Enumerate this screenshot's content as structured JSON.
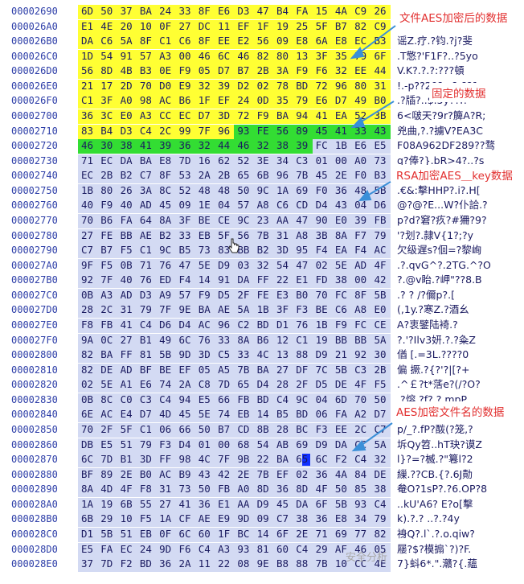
{
  "hex_view": {
    "rows": [
      {
        "addr": "00002690",
        "bytes": [
          "6D",
          "50",
          "37",
          "BA",
          "24",
          "33",
          "8F",
          "E6",
          "D3",
          "47",
          "B4",
          "FA",
          "15",
          "4A",
          "C9",
          "26"
        ],
        "ascii": ""
      },
      {
        "addr": "000026A0",
        "bytes": [
          "E1",
          "4E",
          "20",
          "10",
          "0F",
          "27",
          "DC",
          "11",
          "EF",
          "1F",
          "19",
          "25",
          "5F",
          "B7",
          "82",
          "C9"
        ],
        "ascii": ""
      },
      {
        "addr": "000026B0",
        "bytes": [
          "DA",
          "C6",
          "5A",
          "8F",
          "C1",
          "C6",
          "8F",
          "EE",
          "E2",
          "56",
          "09",
          "E8",
          "6A",
          "E8",
          "EC",
          "B3"
        ],
        "ascii": "谣Z.疗.?钧.?j?斐"
      },
      {
        "addr": "000026C0",
        "bytes": [
          "1D",
          "54",
          "91",
          "57",
          "A3",
          "00",
          "46",
          "6C",
          "46",
          "82",
          "80",
          "13",
          "3F",
          "35",
          "79",
          "6F"
        ],
        "ascii": ".T憼?'F1F?..?5yo"
      },
      {
        "addr": "000026D0",
        "bytes": [
          "56",
          "8D",
          "4B",
          "B3",
          "0E",
          "F9",
          "05",
          "D7",
          "B7",
          "2B",
          "3A",
          "F9",
          "F6",
          "32",
          "EE",
          "44"
        ],
        "ascii": "V.K?.?.?:???頓"
      },
      {
        "addr": "000026E0",
        "bytes": [
          "21",
          "17",
          "2D",
          "70",
          "D0",
          "E9",
          "32",
          "39",
          "D2",
          "02",
          "78",
          "BD",
          "72",
          "96",
          "80",
          "31"
        ],
        "ascii": "!.-p??29?.x?r??1"
      },
      {
        "addr": "000026F0",
        "bytes": [
          "C1",
          "3F",
          "A0",
          "98",
          "AC",
          "B6",
          "1F",
          "EF",
          "24",
          "0D",
          "35",
          "79",
          "E6",
          "D7",
          "49",
          "B0"
        ],
        "ascii": ".?牐?..$.5y??I?"
      },
      {
        "addr": "00002700",
        "bytes": [
          "36",
          "3C",
          "E0",
          "A3",
          "CC",
          "EC",
          "D7",
          "3D",
          "72",
          "F9",
          "BA",
          "94",
          "41",
          "EA",
          "52",
          "3B"
        ],
        "ascii": "6<啵天?9r?簲A?R;"
      },
      {
        "addr": "00002710",
        "bytes": [
          "83",
          "B4",
          "D3",
          "C4",
          "2C",
          "99",
          "7F",
          "96",
          "93",
          "FE",
          "56",
          "89",
          "45",
          "41",
          "33",
          "43"
        ],
        "ascii": "兇曲,?.?擄V?EA3C"
      },
      {
        "addr": "00002720",
        "bytes": [
          "46",
          "30",
          "38",
          "41",
          "39",
          "36",
          "32",
          "44",
          "46",
          "32",
          "38",
          "39",
          "FC",
          "1B",
          "E6",
          "E5"
        ],
        "ascii": "F08A962DF289??骛"
      },
      {
        "addr": "00002730",
        "bytes": [
          "71",
          "EC",
          "DA",
          "BA",
          "E8",
          "7D",
          "16",
          "62",
          "52",
          "3E",
          "34",
          "C3",
          "01",
          "00",
          "A0",
          "73"
        ],
        "ascii": "q?俸?}.bR>4?..?s"
      },
      {
        "addr": "00002740",
        "bytes": [
          "EC",
          "2B",
          "B2",
          "C7",
          "8F",
          "53",
          "2A",
          "2B",
          "65",
          "6B",
          "96",
          "7B",
          "45",
          "2E",
          "F0",
          "B3"
        ],
        "ascii": "?+?.S*+ek?{E.?"
      },
      {
        "addr": "00002750",
        "bytes": [
          "1B",
          "80",
          "26",
          "3A",
          "8C",
          "52",
          "48",
          "48",
          "50",
          "9C",
          "1A",
          "69",
          "F0",
          "36",
          "48",
          "5B"
        ],
        "ascii": ".€&:擊HHP?.i?.H["
      },
      {
        "addr": "00002760",
        "bytes": [
          "40",
          "F9",
          "40",
          "AD",
          "45",
          "09",
          "1E",
          "04",
          "57",
          "A8",
          "C6",
          "CD",
          "D4",
          "43",
          "04",
          "D6"
        ],
        "ascii": "@?@?E...W?仆詥.?"
      },
      {
        "addr": "00002770",
        "bytes": [
          "70",
          "B6",
          "FA",
          "64",
          "8A",
          "3F",
          "BE",
          "CE",
          "9C",
          "23",
          "AA",
          "47",
          "90",
          "E0",
          "39",
          "FB"
        ],
        "ascii": "p?d?窘?疚?#狦?9?"
      },
      {
        "addr": "00002780",
        "bytes": [
          "27",
          "FE",
          "BB",
          "AE",
          "B2",
          "33",
          "EB",
          "5F",
          "56",
          "7B",
          "31",
          "A8",
          "3B",
          "8A",
          "F7",
          "79"
        ],
        "ascii": "'?划?.隷V{1?;?y"
      },
      {
        "addr": "00002790",
        "bytes": [
          "C7",
          "B7",
          "F5",
          "C1",
          "9C",
          "B5",
          "73",
          "83",
          "BB",
          "B2",
          "3D",
          "95",
          "F4",
          "EA",
          "F4",
          "AC"
        ],
        "ascii": "欠级遅s?佪=?黎峋"
      },
      {
        "addr": "000027A0",
        "bytes": [
          "9F",
          "F5",
          "0B",
          "71",
          "76",
          "47",
          "5E",
          "D9",
          "03",
          "32",
          "54",
          "47",
          "02",
          "5E",
          "AD",
          "4F"
        ],
        "ascii": ".?.qvG^?.2TG.^?O"
      },
      {
        "addr": "000027B0",
        "bytes": [
          "92",
          "7F",
          "40",
          "76",
          "ED",
          "F4",
          "14",
          "91",
          "DA",
          "FF",
          "22",
          "E1",
          "FD",
          "38",
          "00",
          "42"
        ],
        "ascii": "?.@v眙.?岬\"??8.B"
      },
      {
        "addr": "000027C0",
        "bytes": [
          "0B",
          "A3",
          "AD",
          "D3",
          "A9",
          "57",
          "F9",
          "D5",
          "2F",
          "FE",
          "E3",
          "B0",
          "70",
          "FC",
          "8F",
          "5B"
        ],
        "ascii": ".?  ? /?儞p?.["
      },
      {
        "addr": "000027D0",
        "bytes": [
          "28",
          "2C",
          "31",
          "79",
          "7F",
          "9E",
          "BA",
          "AE",
          "5A",
          "1B",
          "3F",
          "F3",
          "BE",
          "C6",
          "A8",
          "E0"
        ],
        "ascii": "(,1y.?寒Z.?酒幺"
      },
      {
        "addr": "000027E0",
        "bytes": [
          "F8",
          "FB",
          "41",
          "C4",
          "D6",
          "D4",
          "AC",
          "96",
          "C2",
          "BD",
          "D1",
          "76",
          "1B",
          "F9",
          "FC",
          "CE"
        ],
        "ascii": "  A?衷鐾陆裿.?"
      },
      {
        "addr": "000027F0",
        "bytes": [
          "9A",
          "0C",
          "27",
          "B1",
          "49",
          "6C",
          "76",
          "33",
          "8A",
          "B6",
          "12",
          "C1",
          "19",
          "BB",
          "BB",
          "5A"
        ],
        "ascii": "?.'?Ilv3妍.?.?粂Z"
      },
      {
        "addr": "00002800",
        "bytes": [
          "82",
          "BA",
          "FF",
          "81",
          "5B",
          "9D",
          "3D",
          "C5",
          "33",
          "4C",
          "13",
          "88",
          "D9",
          "21",
          "92",
          "30"
        ],
        "ascii": "偤  [.=3L.????0"
      },
      {
        "addr": "00002810",
        "bytes": [
          "82",
          "DE",
          "AD",
          "BF",
          "BE",
          "EF",
          "05",
          "A5",
          "7B",
          "BA",
          "27",
          "DF",
          "7C",
          "5B",
          "C3",
          "2B"
        ],
        "ascii": "偏 撅.?{?'?|[?+"
      },
      {
        "addr": "00002820",
        "bytes": [
          "02",
          "5E",
          "A1",
          "E6",
          "74",
          "2A",
          "C8",
          "7D",
          "65",
          "D4",
          "28",
          "2F",
          "D5",
          "DE",
          "4F",
          "F5"
        ],
        "ascii": ".^￡?t*萿e?(/?O?"
      },
      {
        "addr": "00002830",
        "bytes": [
          "0B",
          "8C",
          "C0",
          "C3",
          "C4",
          "94",
          "E5",
          "66",
          "FB",
          "BD",
          "C4",
          "9C",
          "04",
          "6D",
          "70",
          "50"
        ],
        "ascii": ".?熔.?f?.?.mpP"
      },
      {
        "addr": "00002840",
        "bytes": [
          "6E",
          "AC",
          "E4",
          "D7",
          "4D",
          "45",
          "5E",
          "74",
          "EB",
          "14",
          "B5",
          "BD",
          "06",
          "FA",
          "A2",
          "D7"
        ],
        "ascii": "n?譓E^t?.?.?"
      },
      {
        "addr": "00002850",
        "bytes": [
          "70",
          "2F",
          "5F",
          "C1",
          "06",
          "66",
          "50",
          "B7",
          "CD",
          "8B",
          "28",
          "BC",
          "F3",
          "EE",
          "2C",
          "C7"
        ],
        "ascii": "p/_?.fP?酦(?笼,?"
      },
      {
        "addr": "00002860",
        "bytes": [
          "DB",
          "E5",
          "51",
          "79",
          "F3",
          "D4",
          "01",
          "00",
          "68",
          "54",
          "AB",
          "69",
          "D9",
          "DA",
          "CC",
          "5A"
        ],
        "ascii": "坼Qy笤..hT玦?谟Z"
      },
      {
        "addr": "00002870",
        "bytes": [
          "6C",
          "7D",
          "B1",
          "3D",
          "FF",
          "98",
          "4C",
          "7F",
          "9B",
          "22",
          "BA",
          "65",
          "6C",
          "F2",
          "C4",
          "32"
        ],
        "ascii": "l}?=?楲.?\"篹l?2"
      },
      {
        "addr": "00002880",
        "bytes": [
          "BF",
          "89",
          "2E",
          "B0",
          "AC",
          "B9",
          "43",
          "42",
          "2E",
          "7B",
          "EF",
          "02",
          "36",
          "4A",
          "84",
          "DE"
        ],
        "ascii": "繅.??CB.{?.6J勣"
      },
      {
        "addr": "00002890",
        "bytes": [
          "8A",
          "4D",
          "4F",
          "F8",
          "31",
          "73",
          "50",
          "FB",
          "A0",
          "8D",
          "36",
          "8D",
          "4F",
          "50",
          "85",
          "38"
        ],
        "ascii": "奙O?1sP?.?6.OP?8"
      },
      {
        "addr": "000028A0",
        "bytes": [
          "1A",
          "19",
          "6B",
          "55",
          "27",
          "41",
          "36",
          "E1",
          "AA",
          "D9",
          "45",
          "DA",
          "6F",
          "5B",
          "93",
          "C4"
        ],
        "ascii": "..kU'A6?  E?o[擊"
      },
      {
        "addr": "000028B0",
        "bytes": [
          "6B",
          "29",
          "10",
          "F5",
          "1A",
          "CF",
          "AE",
          "E9",
          "9D",
          "09",
          "C7",
          "38",
          "36",
          "E8",
          "34",
          "79"
        ],
        "ascii": "k).?.?  ..?.?4y"
      },
      {
        "addr": "000028C0",
        "bytes": [
          "D1",
          "5B",
          "51",
          "EB",
          "0F",
          "6C",
          "60",
          "1F",
          "BC",
          "14",
          "6F",
          "2E",
          "71",
          "69",
          "77",
          "82"
        ],
        "ascii": "裑Q?.l`.?.o.qiw?"
      },
      {
        "addr": "000028D0",
        "bytes": [
          "E5",
          "FA",
          "EC",
          "24",
          "9D",
          "F6",
          "C4",
          "A3",
          "93",
          "81",
          "60",
          "C4",
          "29",
          "AF",
          "46",
          "05"
        ],
        "ascii": "屦?$?模搧`?)?F."
      },
      {
        "addr": "000028E0",
        "bytes": [
          "37",
          "7D",
          "F2",
          "BD",
          "36",
          "2A",
          "11",
          "22",
          "08",
          "9E",
          "B8",
          "88",
          "7B",
          "10",
          "CC",
          "4E"
        ],
        "ascii": "7}蚪6*.\".灨?{.蘊"
      }
    ]
  },
  "annotations": {
    "encrypted_data": "文件AES加密后的数据",
    "fixed_data": "固定的数据",
    "rsa_key_data": "RSA加密AES＿key数据",
    "aes_filename_data": "AES加密文件名的数据"
  },
  "watermark": "安全分析",
  "colors": {
    "address": "#2d3ea8",
    "bytes": "#1a1a60",
    "yellow_highlight": "#ffff33",
    "green_highlight": "#33dd33",
    "lavender_highlight": "#d3daf3",
    "cursor": "#1030ff",
    "annotation": "#e23030",
    "arrow": "#3a8fd8"
  },
  "cursor": {
    "row": "00002870",
    "byte_index": 11
  }
}
